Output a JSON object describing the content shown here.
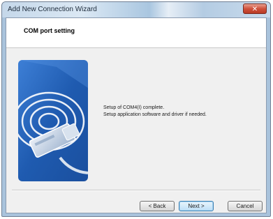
{
  "window": {
    "title": "Add New Connection Wizard",
    "close_glyph": "✕"
  },
  "header": {
    "title": "COM port setting"
  },
  "message": {
    "line1": "Setup of COM4(I) complete.",
    "line2": "Setup application software and driver if needed."
  },
  "buttons": {
    "back": "< Back",
    "next": "Next >",
    "cancel": "Cancel"
  },
  "colors": {
    "image_blue": "#1f5bb0",
    "image_light": "#4f8fdd"
  }
}
